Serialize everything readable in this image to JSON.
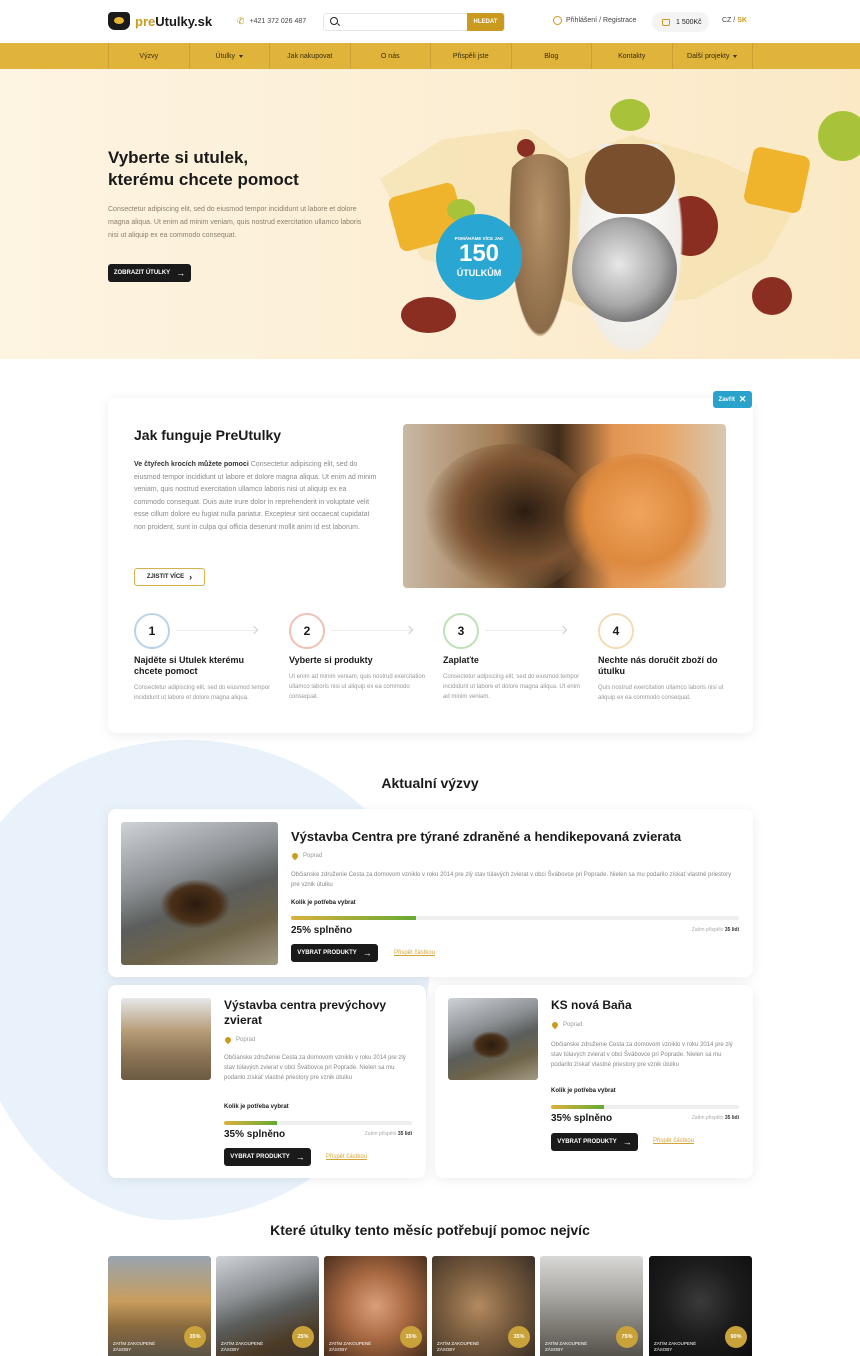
{
  "header": {
    "logo_pre": "pre",
    "logo_rest": "Utulky.sk",
    "phone": "+421 372 026 487",
    "search_placeholder": "",
    "search_button": "HLEDAT",
    "login": "Přihlášení / Registrace",
    "cart": "1 500Kč",
    "lang_cz": "CZ /",
    "lang_sk": "SK"
  },
  "nav": {
    "items": [
      "Výzvy",
      "Útulky",
      "Jak nakupovat",
      "O nás",
      "Přispěli jste",
      "Blog",
      "Kontakty",
      "Další projekty"
    ]
  },
  "hero": {
    "title_line1": "Vyberte si utulek,",
    "title_line2": "kterému chcete pomoct",
    "text": "Consectetur adipiscing elit, sed do eiusmod tempor incididunt ut labore et dolore magna aliqua. Ut enim ad minim veniam, quis nostrud exercitation ullamco laboris nisi ut aliquip ex ea commodo consequat.",
    "button": "ZOBRAZIT ÚTULKY",
    "badge_small": "POMÁHÁME VÍCE JAK",
    "badge_number": "150",
    "badge_bottom": "ÚTULKŮM"
  },
  "how": {
    "close": "Zavřít",
    "title": "Jak funguje PreUtulky",
    "text_bold": "Ve čtyřech krocích můžete pomoci",
    "text": " Consectetur adipiscing elit, sed do eiusmod tempor incididunt ut labore et dolore magna aliqua. Ut enim ad minim veniam, quis nostrud exercitation ullamco laboris nisi ut aliquip ex ea commodo consequat. Duis aute irure dolor in reprehenderit in voluptate velit esse cillum dolore eu fugiat nulla pariatur. Excepteur sint occaecat cupidatat non proident, sunt in culpa qui officia deserunt mollit anim id est laborum.",
    "button": "ZJISTIT VÍCE",
    "steps": [
      {
        "num": "1",
        "title": "Najděte si Utulek kterému chcete pomoct",
        "text": "Consectetur adipiscing elit, sed do eiusmod tempor incididunt ut labore et dolore magna aliqua.",
        "color": "#b9d3ea"
      },
      {
        "num": "2",
        "title": "Vyberte si produkty",
        "text": "Ut enim ad minim veniam, quis nostrud exercitation ullamco laboris nisi ut aliquip ex ea commodo consequat.",
        "color": "#f0c0b5"
      },
      {
        "num": "3",
        "title": "Zaplaťte",
        "text": "Consectetur adipiscing elit, sed do eiusmod tempor incididunt ut labore et dolore magna aliqua. Ut enim ad minim veniam.",
        "color": "#bfe0b5"
      },
      {
        "num": "4",
        "title": "Nechte nás doručit zboží do útulku",
        "text": "Quis nostrud exercitation ullamco laboris nisi ut aliquip ex ea commodo consequat.",
        "color": "#f3dbb7"
      }
    ]
  },
  "challenges": {
    "title": "Aktualní výzvy",
    "main": {
      "title": "Výstavba Centra pre týrané zdraněné a hendikepovaná zvierata",
      "location": "Poprad",
      "desc": "Občianske združenie Cesta za domovom vzniklo v roku 2014 pre zlý stav túlavých zvierat v obci Švábovce pri Poprade. Nielen sa mu podarilo získať vlastné priestory pre vznik útulku",
      "need": "Kolik je potřeba vybrat",
      "percent": "25% splněno",
      "progress": 0.28,
      "people_label": "Zatím přispělo",
      "people_count": "35 lidí",
      "button": "VYBRAT PRODUKTY",
      "link": "Přispět částkou"
    },
    "left": {
      "title": "Výstavba centra prevýchovy zvierat",
      "location": "Poprad",
      "desc": "Občianske združenie Cesta za domovom vzniklo v roku 2014 pre zlý stav túlavých zvierat v obci Švábovce pri Poprade. Nielen sa mu podarilo získať vlastné priestory pre vznik útulku",
      "need": "Kolik je potřeba vybrat",
      "percent": "35% splněno",
      "progress": 0.28,
      "people_label": "Zatím přispělo",
      "people_count": "35 lidí",
      "button": "VYBRAT PRODUKTY",
      "link": "Přispět částkou"
    },
    "right": {
      "title": "KS nová Baňa",
      "location": "Poprad",
      "desc": "Občianske združenie Cesta za domovom vzniklo v roku 2014 pre zlý stav túlavých zvierat v obci Švábovce pri Poprade. Nielen sa mu podarilo získať vlastné priestory pre vznik útulku",
      "need": "Kolik je potřeba vybrat",
      "percent": "35% splněno",
      "progress": 0.28,
      "people_label": "Zatím přispělo",
      "people_count": "35 lidí",
      "button": "VYBRAT PRODUKTY",
      "link": "Přispět částkou"
    }
  },
  "shelters": {
    "title": "Které útulky tento měsíc potřebují pomoc nejvíc",
    "tiles": [
      {
        "label": "ZATÍM ZAKOUPENÉ ZÁSOBY",
        "pct": "35%"
      },
      {
        "label": "ZATÍM ZAKOUPENÉ ZÁSOBY",
        "pct": "25%"
      },
      {
        "label": "ZATÍM ZAKOUPENÉ ZÁSOBY",
        "pct": "15%"
      },
      {
        "label": "ZATÍM ZAKOUPENÉ ZÁSOBY",
        "pct": "35%"
      },
      {
        "label": "ZATÍM ZAKOUPENÉ ZÁSOBY",
        "pct": "75%"
      },
      {
        "label": "ZATÍM ZAKOUPENÉ ZÁSOBY",
        "pct": "90%"
      }
    ]
  },
  "colors": {
    "accent": "#e0b43b",
    "gold": "#c99a1e",
    "blue": "#29a6d1"
  }
}
